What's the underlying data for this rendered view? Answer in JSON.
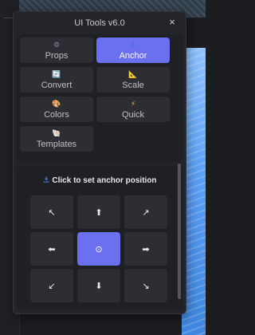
{
  "window": {
    "title": "UI Tools v6.0",
    "close_label": "×"
  },
  "tabs": [
    {
      "label": "Props",
      "icon": "gear-icon",
      "glyph": "⚙",
      "color": "#8a8f98"
    },
    {
      "label": "Anchor",
      "icon": "anchor-icon",
      "glyph": "⚓",
      "color": "#3a6fe0"
    },
    {
      "label": "Convert",
      "icon": "convert-icon",
      "glyph": "🔄",
      "color": "#4fa0ff"
    },
    {
      "label": "Scale",
      "icon": "ruler-triangle-icon",
      "glyph": "📐",
      "color": "#f3b23b"
    },
    {
      "label": "Colors",
      "icon": "palette-icon",
      "glyph": "🎨",
      "color": "#e07a52"
    },
    {
      "label": "Quick",
      "icon": "lightning-icon",
      "glyph": "⚡",
      "color": "#f5c518"
    },
    {
      "label": "Templates",
      "icon": "shell-icon",
      "glyph": "🐚",
      "color": "#f2a0a0"
    }
  ],
  "active_tab": "Anchor",
  "anchor": {
    "heading": "Click to set anchor position",
    "heading_icon": "⚓",
    "grid": [
      {
        "name": "top-left",
        "glyph": "↖"
      },
      {
        "name": "top",
        "glyph": "⬆"
      },
      {
        "name": "top-right",
        "glyph": "↗"
      },
      {
        "name": "left",
        "glyph": "⬅"
      },
      {
        "name": "center",
        "glyph": "⊙"
      },
      {
        "name": "right",
        "glyph": "➡"
      },
      {
        "name": "bottom-left",
        "glyph": "↙"
      },
      {
        "name": "bottom",
        "glyph": "⬇"
      },
      {
        "name": "bottom-right",
        "glyph": "↘"
      }
    ],
    "selected": "center"
  },
  "colors": {
    "accent": "#6b70f0",
    "window_bg": "#242529",
    "panel_bg": "#1f2024",
    "button_bg": "#2d2e33"
  }
}
